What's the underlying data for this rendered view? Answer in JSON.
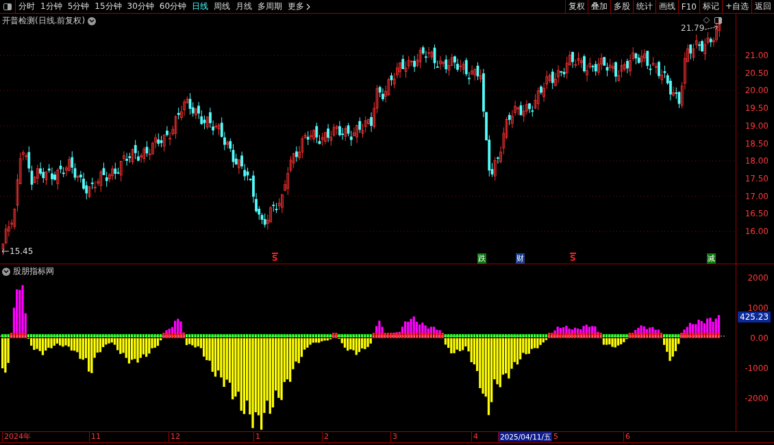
{
  "toolbar": {
    "periods": [
      {
        "label": "分时",
        "selected": false
      },
      {
        "label": "1分钟",
        "selected": false
      },
      {
        "label": "5分钟",
        "selected": false
      },
      {
        "label": "15分钟",
        "selected": false
      },
      {
        "label": "30分钟",
        "selected": false
      },
      {
        "label": "60分钟",
        "selected": false
      },
      {
        "label": "日线",
        "selected": true
      },
      {
        "label": "周线",
        "selected": false
      },
      {
        "label": "月线",
        "selected": false
      },
      {
        "label": "多周期",
        "selected": false
      }
    ],
    "more": "更多",
    "actions": [
      "复权",
      "叠加",
      "多股",
      "统计",
      "画线",
      "F10",
      "标记",
      "+自选",
      "返回"
    ]
  },
  "main_chart": {
    "title": "开普检测(日线.前复权)",
    "price_ticks": [
      "21.00",
      "20.50",
      "20.00",
      "19.50",
      "19.00",
      "18.50",
      "18.00",
      "17.50",
      "17.00",
      "16.50",
      "16.00"
    ],
    "high_label": "21.79",
    "low_label": "15.45",
    "events": [
      {
        "label": "S",
        "kind": "signal",
        "color": "#ff2020"
      },
      {
        "label": "跌",
        "kind": "tag",
        "color": "#0a7a0a"
      },
      {
        "label": "财",
        "kind": "tag",
        "color": "#1a3f8a"
      },
      {
        "label": "S",
        "kind": "signal",
        "color": "#ff2020"
      },
      {
        "label": "减",
        "kind": "tag",
        "color": "#0a7a0a"
      }
    ]
  },
  "indicator": {
    "title": "股朋指标网",
    "ticks": [
      "2000",
      "1000",
      "0.00",
      "-1000",
      "-2000"
    ],
    "current_value": "425.23"
  },
  "time_axis": {
    "labels": [
      {
        "label": "2024年",
        "selected": false
      },
      {
        "label": "11",
        "selected": false
      },
      {
        "label": "12",
        "selected": false
      },
      {
        "label": "1",
        "selected": false
      },
      {
        "label": "2",
        "selected": false
      },
      {
        "label": "3",
        "selected": false
      },
      {
        "label": "4",
        "selected": false
      },
      {
        "label": "2025/04/11/五",
        "selected": true
      },
      {
        "label": "5",
        "selected": false
      },
      {
        "label": "6",
        "selected": false
      }
    ]
  }
}
